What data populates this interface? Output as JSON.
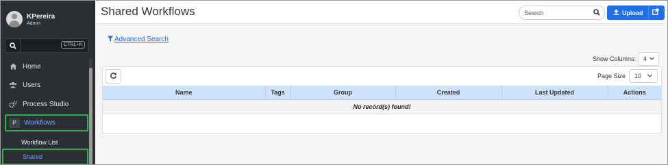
{
  "user": {
    "name": "KPereira",
    "role": "Admin"
  },
  "sidebar": {
    "search_shortcut": "CTRL+K",
    "items": [
      {
        "label": "Home",
        "icon": "home-icon"
      },
      {
        "label": "Users",
        "icon": "users-icon"
      },
      {
        "label": "Process Studio",
        "icon": "cogs-icon"
      },
      {
        "label": "Workflows",
        "icon": "workflow-icon",
        "icon_glyph": "P"
      }
    ],
    "subitems": [
      {
        "label": "Workflow List"
      },
      {
        "label": "Shared"
      }
    ]
  },
  "header": {
    "title": "Shared Workflows",
    "search_placeholder": "Search",
    "upload_label": "Upload"
  },
  "advanced_search_label": "Advanced Search",
  "show_columns": {
    "label": "Show Columns:",
    "value": "4"
  },
  "page_size": {
    "label": "Page Size",
    "value": "10"
  },
  "table": {
    "columns": [
      "Name",
      "Tags",
      "Group",
      "Created",
      "Last Updated",
      "Actions"
    ],
    "empty_message": "No record(s) found!"
  },
  "colors": {
    "accent": "#1f6fe5",
    "sidebar_bg": "#2b2f33",
    "table_header": "#cfe2fb",
    "highlight_border": "#29b44a"
  }
}
